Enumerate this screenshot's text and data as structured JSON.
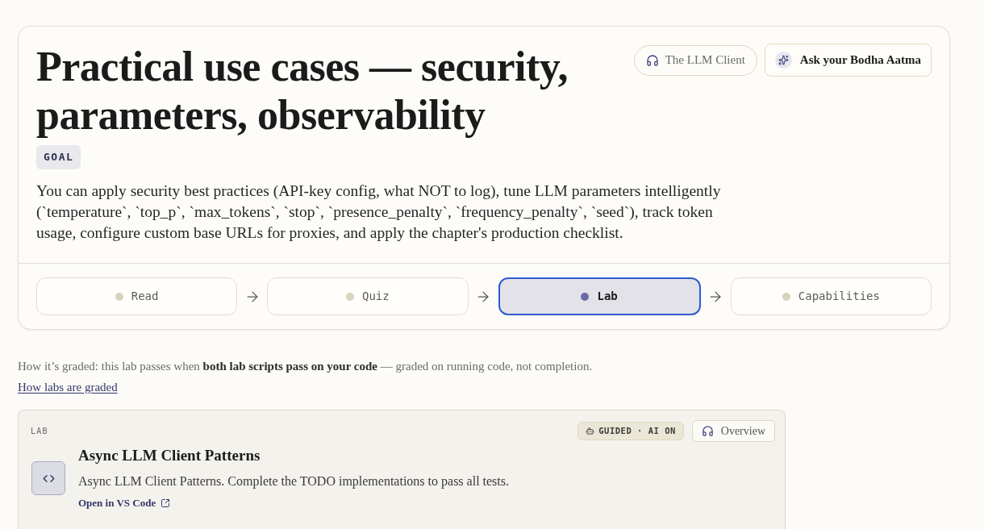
{
  "header": {
    "title": "Practical use cases — security, parameters, observability",
    "buttons": [
      {
        "kind": "audio",
        "label": "The LLM Client"
      },
      {
        "kind": "assistant",
        "label": "Ask your Bodha Aatma"
      }
    ]
  },
  "goal": {
    "badge": "GOAL",
    "text": "You can apply security best practices (API-key config, what NOT to log), tune LLM parameters intelligently (`temperature`, `top_p`, `max_tokens`, `stop`, `presence_penalty`, `frequency_penalty`, `seed`), track token usage, configure custom base URLs for proxies, and apply the chapter's production checklist."
  },
  "steps": [
    {
      "label": "Read",
      "selected": false
    },
    {
      "label": "Quiz",
      "selected": false
    },
    {
      "label": "Lab",
      "selected": true
    },
    {
      "label": "Capabilities",
      "selected": false
    }
  ],
  "grading": {
    "text": "How it’s graded: this lab passes when **both lab scripts pass on your code** — graded on running code, not completion.",
    "link": "How labs are graded"
  },
  "lab": {
    "eyebrow": "LAB",
    "mode_badge": "GUIDED · AI ON",
    "overview_button": "Overview",
    "title": "Async LLM Client Patterns",
    "description": "Async LLM Client Patterns. Complete the TODO implementations to pass all tests.",
    "link": "Open in VS Code"
  }
}
